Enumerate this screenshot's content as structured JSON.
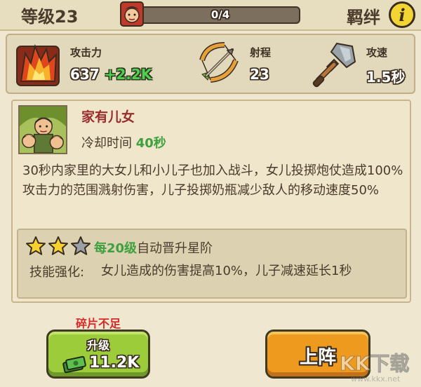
{
  "header": {
    "level": "等级23",
    "progress_text": "0/4",
    "progress_fraction": 0.0,
    "bond": "羁绊",
    "info_icon": "i"
  },
  "stats": {
    "attack": {
      "icon": "flame-icon",
      "label": "攻击力",
      "value": "637",
      "bonus": "+2.2K"
    },
    "range": {
      "icon": "bow-icon",
      "label": "射程",
      "value": "23"
    },
    "speed": {
      "icon": "shovel-icon",
      "label": "攻速",
      "value": "1.5秒"
    }
  },
  "skill": {
    "name": "家有儿女",
    "cooldown_label": "冷却时间",
    "cooldown_value": "40秒",
    "description": "30秒内家里的大女儿和小儿子也加入战斗，女儿投掷炮仗造成100%攻击力的范围溅射伤害，儿子投掷奶瓶减少敌人的移动速度50%",
    "stars_filled": 2,
    "stars_total": 3,
    "auto_prefix": "每20级",
    "auto_suffix": "自动晋升星阶",
    "enhance_label": "技能强化:",
    "enhance_text": "女儿造成的伤害提高10%，儿子减速延长1秒"
  },
  "footer": {
    "shortage": "碎片不足",
    "upgrade_label": "升级",
    "upgrade_cost": "11.2K",
    "deploy_label": "上阵",
    "watermark": "KK下载 www.kkx.net"
  },
  "colors": {
    "background": "#efe7cf",
    "upgrade_button": "#9ccc3a",
    "deploy_button": "#ee9a1f",
    "highlight_green": "#3ea03e",
    "skill_name": "#9a2d2d",
    "shortage_red": "#d82a2a"
  }
}
